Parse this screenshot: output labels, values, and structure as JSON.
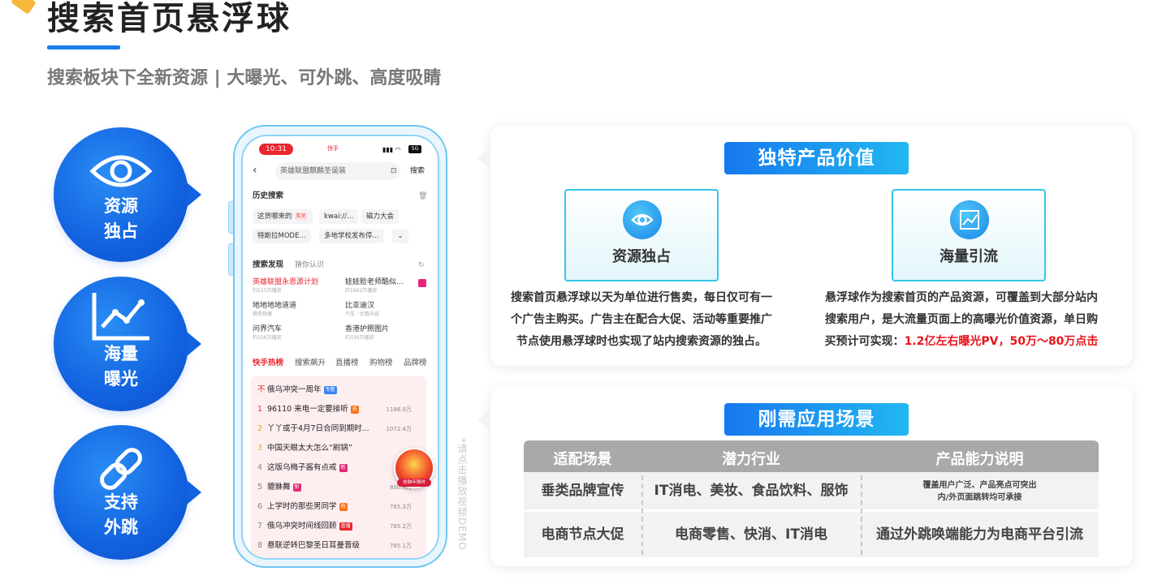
{
  "header": {
    "title": "搜索首页悬浮球",
    "subtitle": "搜索板块下全新资源 | 大曝光、可外跳、高度吸睛"
  },
  "features": [
    {
      "line1": "资源",
      "line2": "独占",
      "icon": "eye-icon"
    },
    {
      "line1": "海量",
      "line2": "曝光",
      "icon": "line-chart-icon"
    },
    {
      "line1": "支持",
      "line2": "外跳",
      "icon": "link-icon"
    }
  ],
  "phone": {
    "time": "10:31",
    "app_name": "快手",
    "battery": "5G",
    "search_placeholder": "英雄联盟麒麟圣诞装",
    "search_button": "搜索",
    "history_title": "历史搜索",
    "history_chips": [
      "这货哪来的",
      "kwai://...",
      "磁力大会",
      "特斯拉MODE...",
      "多地学校发布停..."
    ],
    "history_chip_tag": "实况",
    "discover_title": "搜索发现",
    "discover_sub": "猜你认识",
    "discover_items": [
      {
        "title": "英雄联盟永恩源计划",
        "meta": "约525万播放"
      },
      {
        "title": "娃娃脸老师酷似...",
        "meta": "约1902万播放"
      },
      {
        "title": "地地地地道道",
        "meta": "猜你想搜"
      },
      {
        "title": "比亚迪汉",
        "meta": "汽车 · 优惠内容"
      },
      {
        "title": "问界汽车",
        "meta": "约256万播放"
      },
      {
        "title": "香港护照图片",
        "meta": "约330万播放"
      }
    ],
    "tabs": [
      "快手热榜",
      "搜索飙升",
      "直播榜",
      "购物榜",
      "品牌榜"
    ],
    "hot_list": [
      {
        "rank": "",
        "title": "俄乌冲突一周年",
        "value": ""
      },
      {
        "rank": "1",
        "title": "96110 来电一定要接听",
        "value": "1186.9万"
      },
      {
        "rank": "2",
        "title": "丫丫或于4月7日合同到期时...",
        "value": "1072.4万"
      },
      {
        "rank": "3",
        "title": "中国天眼太大怎么“刷锅”",
        "value": ""
      },
      {
        "rank": "4",
        "title": "这版乌梅子酱有点戒",
        "value": ""
      },
      {
        "rank": "5",
        "title": "貔貅舞",
        "value": "800.8万"
      },
      {
        "rank": "6",
        "title": "上学时的那些男同学",
        "value": "785.3万"
      },
      {
        "rank": "7",
        "title": "俄乌冲突时间线回顾",
        "value": "785.2万"
      },
      {
        "rank": "8",
        "title": "悬联逆转巴黎圣日耳曼晋级",
        "value": "785.1万"
      }
    ],
    "hot_tags": {
      "top": "专题",
      "hot": "热",
      "new": "新",
      "live": "直播"
    },
    "float_ball_label": "抢跨年限时"
  },
  "watermark": "*请点击播放视频DEMO",
  "value_panel": {
    "banner": "独特产品价值",
    "cards": [
      {
        "label": "资源独占",
        "icon": "eye-icon"
      },
      {
        "label": "海量引流",
        "icon": "chart-icon"
      }
    ],
    "left_desc": [
      "搜索首页悬浮球以天为单位进行售卖，每日仅可有一",
      "个广告主购买。广告主在配合大促、活动等重要推广",
      "节点使用悬浮球时也实现了站内搜索资源的独占。"
    ],
    "right_desc": [
      "悬浮球作为搜索首页的产品资源，可覆盖到大部分站内",
      "搜索用户，是大流量页面上的高曝光价值资源，单日购"
    ],
    "right_desc_last_prefix": "买预计可实现：",
    "right_desc_last_highlight": "1.2亿左右曝光PV，50万～80万点击"
  },
  "scene_panel": {
    "banner": "刚需应用场景",
    "headers": [
      "适配场景",
      "潜力行业",
      "产品能力说明"
    ],
    "rows": [
      {
        "scene": "垂类品牌宣传",
        "industry": "IT消电、美妆、食品饮料、服饰",
        "desc_line1": "覆盖用户广泛、产品亮点可突出",
        "desc_line2": "内/外页面跳转均可承接"
      },
      {
        "scene": "电商节点大促",
        "industry": "电商零售、快消、IT消电",
        "desc_line1": "通过外跳唤端能力为电商平台引流",
        "desc_line2": ""
      }
    ]
  }
}
